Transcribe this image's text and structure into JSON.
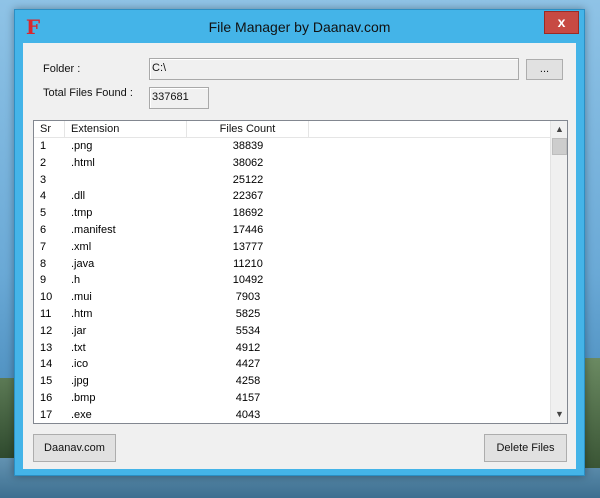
{
  "window": {
    "app_icon": "F",
    "title": "File Manager by Daanav.com",
    "close_label": "x"
  },
  "form": {
    "folder_label": "Folder :",
    "folder_value": "C:\\",
    "browse_label": "...",
    "total_label": "Total Files Found :",
    "total_value": "337681"
  },
  "list": {
    "headers": [
      "Sr",
      "Extension",
      "Files Count"
    ],
    "rows": [
      {
        "sr": "1",
        "ext": ".png",
        "count": "38839"
      },
      {
        "sr": "2",
        "ext": ".html",
        "count": "38062"
      },
      {
        "sr": "3",
        "ext": "",
        "count": "25122"
      },
      {
        "sr": "4",
        "ext": ".dll",
        "count": "22367"
      },
      {
        "sr": "5",
        "ext": ".tmp",
        "count": "18692"
      },
      {
        "sr": "6",
        "ext": ".manifest",
        "count": "17446"
      },
      {
        "sr": "7",
        "ext": ".xml",
        "count": "13777"
      },
      {
        "sr": "8",
        "ext": ".java",
        "count": "11210"
      },
      {
        "sr": "9",
        "ext": ".h",
        "count": "10492"
      },
      {
        "sr": "10",
        "ext": ".mui",
        "count": "7903"
      },
      {
        "sr": "11",
        "ext": ".htm",
        "count": "5825"
      },
      {
        "sr": "12",
        "ext": ".jar",
        "count": "5534"
      },
      {
        "sr": "13",
        "ext": ".txt",
        "count": "4912"
      },
      {
        "sr": "14",
        "ext": ".ico",
        "count": "4427"
      },
      {
        "sr": "15",
        "ext": ".jpg",
        "count": "4258"
      },
      {
        "sr": "16",
        "ext": ".bmp",
        "count": "4157"
      },
      {
        "sr": "17",
        "ext": ".exe",
        "count": "4043"
      }
    ]
  },
  "footer": {
    "website_button": "Daanav.com",
    "delete_button": "Delete Files"
  },
  "icons": {
    "scroll_up": "chevron-up-icon",
    "scroll_down": "chevron-down-icon"
  }
}
